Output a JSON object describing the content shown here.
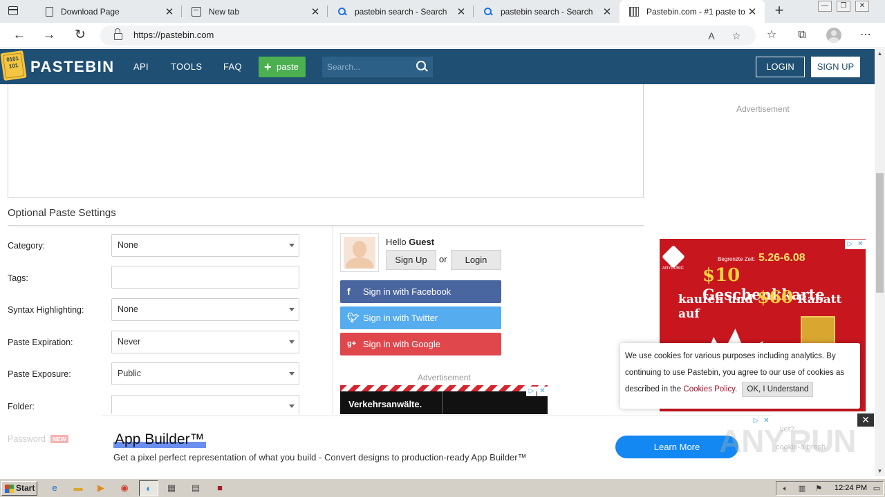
{
  "browser": {
    "tabs": [
      {
        "label": "Download Page",
        "icon": "document-icon"
      },
      {
        "label": "New tab",
        "icon": "new-tab-icon"
      },
      {
        "label": "pastebin search - Search",
        "icon": "search-icon"
      },
      {
        "label": "pastebin search - Search",
        "icon": "search-icon"
      },
      {
        "label": "Pastebin.com - #1 paste to",
        "icon": "pastebin-favicon",
        "active": true
      }
    ],
    "url": "https://pastebin.com"
  },
  "header": {
    "brand": "PASTEBIN",
    "logo_text": "0101 101",
    "nav": [
      "API",
      "TOOLS",
      "FAQ"
    ],
    "paste_button": "paste",
    "search_placeholder": "Search...",
    "login": "LOGIN",
    "signup": "SIGN UP",
    "colors": {
      "bar": "#1f4f73",
      "paste_button": "#4caf50"
    }
  },
  "settings": {
    "title": "Optional Paste Settings",
    "fields": [
      {
        "label": "Category:",
        "value": "None",
        "type": "select"
      },
      {
        "label": "Tags:",
        "value": "",
        "type": "text"
      },
      {
        "label": "Syntax Highlighting:",
        "value": "None",
        "type": "select"
      },
      {
        "label": "Paste Expiration:",
        "value": "Never",
        "type": "select"
      },
      {
        "label": "Paste Exposure:",
        "value": "Public",
        "type": "select"
      },
      {
        "label": "Folder:",
        "value": "",
        "type": "select"
      }
    ],
    "password_label": "Password",
    "new_badge": "NEW"
  },
  "guest": {
    "hello": "Hello",
    "name": "Guest",
    "signup": "Sign Up",
    "or": "or",
    "login": "Login",
    "facebook": "Sign in with Facebook",
    "twitter": "Sign in with Twitter",
    "google": "Sign in with Google",
    "colors": {
      "facebook": "#4a66a0",
      "twitter": "#55acee",
      "google": "#e0474c"
    }
  },
  "ads": {
    "label": "Advertisement",
    "small_ad_text": "Verkehrsanwälte.",
    "right_ad": {
      "brand": "ANYCUBIC",
      "small_line": "Begrenzte Zeit:",
      "date": "5.26-6.08",
      "line1_amount": "$10",
      "line1_text": "Geschenkkarte",
      "line2_pre": "kaufen und",
      "line2_amount": "$60",
      "line2_text": "Rabatt auf"
    },
    "bottom": {
      "title": "App Builder™",
      "description": "Get a pixel perfect representation of what you build - Convert designs to production-ready App Builder™",
      "cta": "Learn More"
    }
  },
  "cookie": {
    "text": "We use cookies for various purposes including analytics. By continuing to use Pastebin, you agree to our use of cookies as described in the",
    "link": "Cookies Policy",
    "button": "OK, I Understand"
  },
  "watermark": {
    "text": "ANY.RUN",
    "sub1": "vet?",
    "sub2": "cookie-a bresh"
  },
  "taskbar": {
    "start": "Start",
    "time": "12:24 PM"
  }
}
